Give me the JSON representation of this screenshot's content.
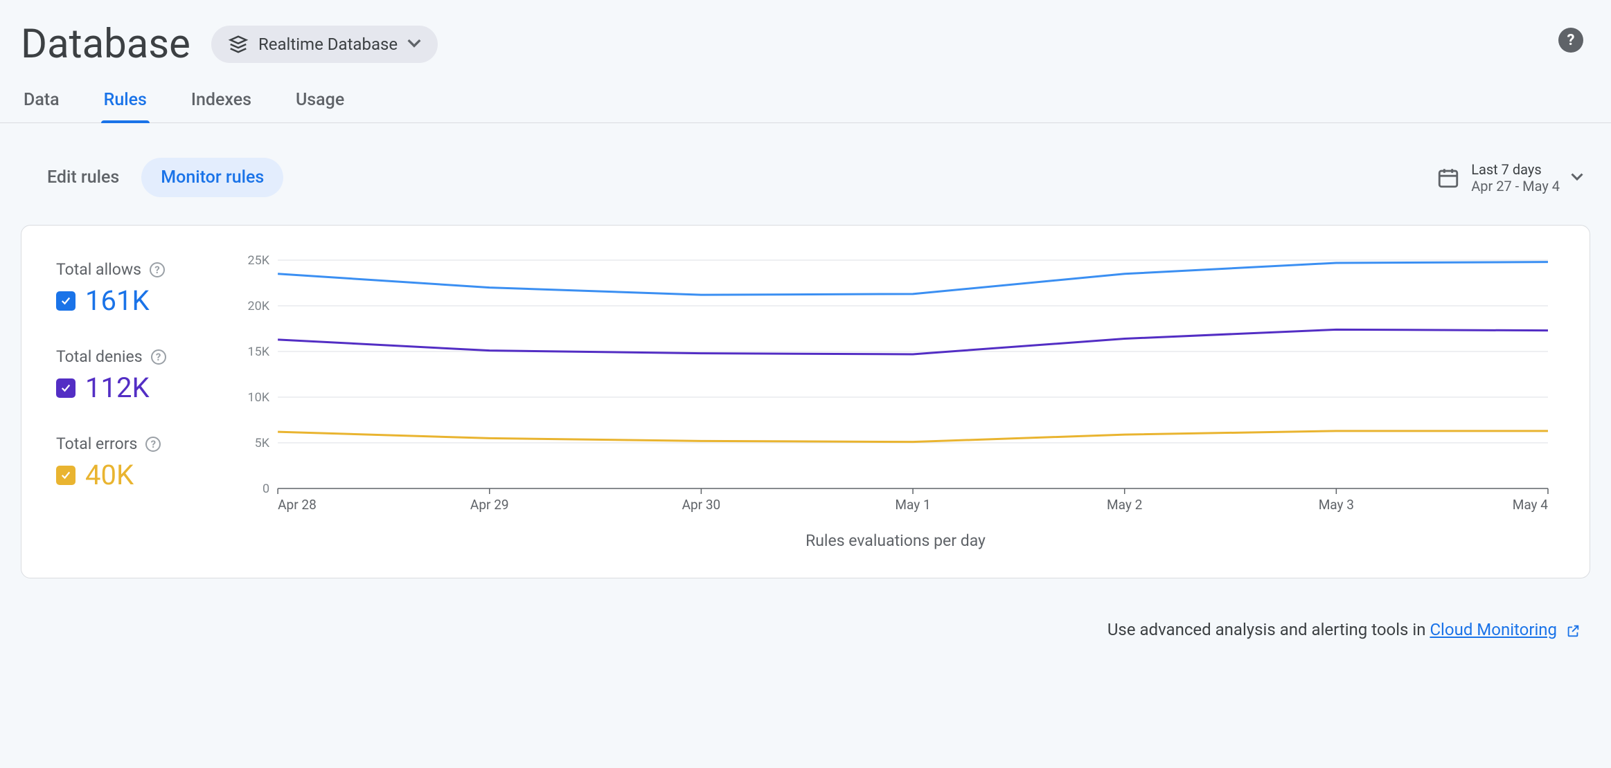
{
  "header": {
    "title": "Database",
    "db_selector_label": "Realtime Database"
  },
  "tabs": [
    {
      "id": "data",
      "label": "Data",
      "active": false
    },
    {
      "id": "rules",
      "label": "Rules",
      "active": true
    },
    {
      "id": "indexes",
      "label": "Indexes",
      "active": false
    },
    {
      "id": "usage",
      "label": "Usage",
      "active": false
    }
  ],
  "subtabs": [
    {
      "id": "edit",
      "label": "Edit rules",
      "active": false
    },
    {
      "id": "monitor",
      "label": "Monitor rules",
      "active": true
    }
  ],
  "date_picker": {
    "range_label": "Last 7 days",
    "range_value": "Apr 27 - May 4"
  },
  "legend": {
    "allows": {
      "label": "Total allows",
      "value": "161K",
      "color": "#1a73e8"
    },
    "denies": {
      "label": "Total denies",
      "value": "112K",
      "color": "#532ec4"
    },
    "errors": {
      "label": "Total errors",
      "value": "40K",
      "color": "#e9b430"
    }
  },
  "chart_data": {
    "type": "line",
    "title": "",
    "xlabel": "Rules evaluations per day",
    "ylabel": "",
    "ylim": [
      0,
      25000
    ],
    "y_ticks": [
      0,
      5000,
      10000,
      15000,
      20000,
      25000
    ],
    "y_tick_labels": [
      "0",
      "5K",
      "10K",
      "15K",
      "20K",
      "25K"
    ],
    "categories": [
      "Apr 28",
      "Apr 29",
      "Apr 30",
      "May 1",
      "May 2",
      "May 3",
      "May 4"
    ],
    "series": [
      {
        "name": "Total allows",
        "color": "#3b8ff2",
        "values": [
          23500,
          22000,
          21200,
          21300,
          23500,
          24700,
          24800
        ]
      },
      {
        "name": "Total denies",
        "color": "#532ec4",
        "values": [
          16300,
          15100,
          14800,
          14700,
          16400,
          17400,
          17300
        ]
      },
      {
        "name": "Total errors",
        "color": "#e9b430",
        "values": [
          6200,
          5500,
          5200,
          5100,
          5900,
          6300,
          6300
        ]
      }
    ]
  },
  "footer": {
    "text": "Use advanced analysis and alerting tools in ",
    "link_label": "Cloud Monitoring"
  }
}
